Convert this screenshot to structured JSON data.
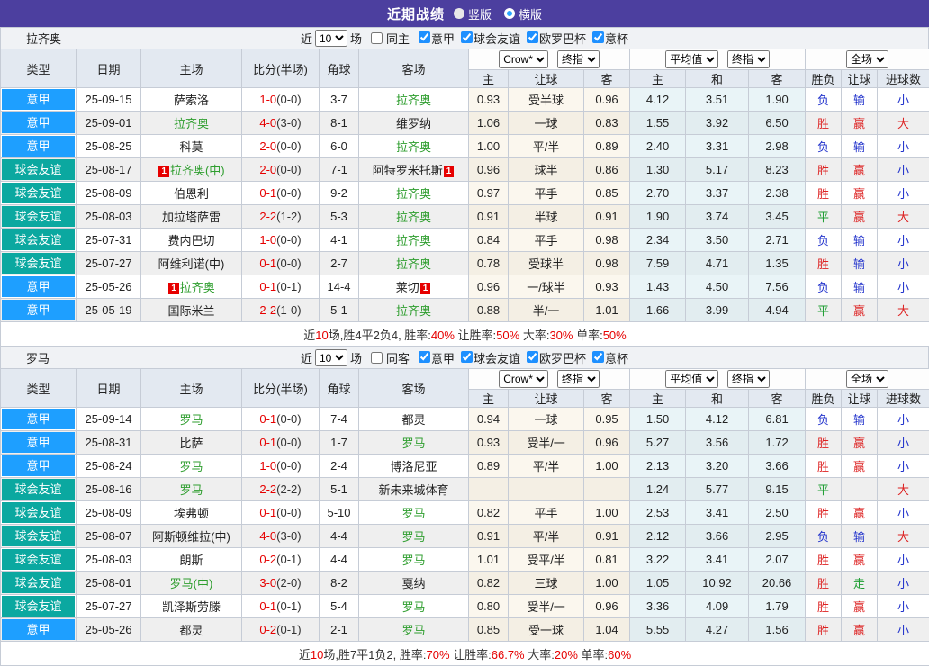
{
  "title_bar": {
    "title": "近期战绩",
    "radios": [
      {
        "label": "竖版",
        "selected": false
      },
      {
        "label": "横版",
        "selected": true
      }
    ]
  },
  "header": {
    "cols": [
      "类型",
      "日期",
      "主场",
      "比分(半场)",
      "角球",
      "客场"
    ],
    "sub": [
      "主",
      "让球",
      "客",
      "主",
      "和",
      "客",
      "胜负",
      "让球",
      "进球数"
    ],
    "selects": {
      "crow": "Crow*",
      "final1": "终指",
      "avg": "平均值",
      "final2": "终指",
      "full": "全场"
    }
  },
  "sections": [
    {
      "team": "拉齐奥",
      "filter": {
        "prefix": "近",
        "count": "10",
        "suffix": "场",
        "same": {
          "label": "同主",
          "checked": false
        },
        "leagues": [
          {
            "label": "意甲",
            "checked": true
          },
          {
            "label": "球会友谊",
            "checked": true
          },
          {
            "label": "欧罗巴杯",
            "checked": true
          },
          {
            "label": "意杯",
            "checked": true
          }
        ]
      },
      "rows": [
        {
          "league": "意甲",
          "lc": "serie",
          "date": "25-09-15",
          "home": "萨索洛",
          "hf": false,
          "hc": false,
          "score": "1-0",
          "half": "(0-0)",
          "corner": "3-7",
          "away": "拉齐奥",
          "af": true,
          "ac": false,
          "h": "0.93",
          "hd": "受半球",
          "a": "0.96",
          "m1": "4.12",
          "m2": "3.51",
          "m3": "1.90",
          "r1": "负",
          "r2": "输",
          "r3": "小"
        },
        {
          "league": "意甲",
          "lc": "serie",
          "date": "25-09-01",
          "home": "拉齐奥",
          "hf": true,
          "hc": false,
          "score": "4-0",
          "half": "(3-0)",
          "corner": "8-1",
          "away": "维罗纳",
          "af": false,
          "ac": false,
          "h": "1.06",
          "hd": "一球",
          "a": "0.83",
          "m1": "1.55",
          "m2": "3.92",
          "m3": "6.50",
          "r1": "胜",
          "r2": "赢",
          "r3": "大"
        },
        {
          "league": "意甲",
          "lc": "serie",
          "date": "25-08-25",
          "home": "科莫",
          "hf": false,
          "hc": false,
          "score": "2-0",
          "half": "(0-0)",
          "corner": "6-0",
          "away": "拉齐奥",
          "af": true,
          "ac": false,
          "h": "1.00",
          "hd": "平/半",
          "a": "0.89",
          "m1": "2.40",
          "m2": "3.31",
          "m3": "2.98",
          "r1": "负",
          "r2": "输",
          "r3": "小"
        },
        {
          "league": "球会友谊",
          "lc": "friendly",
          "date": "25-08-17",
          "home": "拉齐奥(中)",
          "hf": true,
          "hc": true,
          "score": "2-0",
          "half": "(0-0)",
          "corner": "7-1",
          "away": "阿特罗米托斯",
          "af": false,
          "ac": true,
          "h": "0.96",
          "hd": "球半",
          "a": "0.86",
          "m1": "1.30",
          "m2": "5.17",
          "m3": "8.23",
          "r1": "胜",
          "r2": "赢",
          "r3": "小"
        },
        {
          "league": "球会友谊",
          "lc": "friendly",
          "date": "25-08-09",
          "home": "伯恩利",
          "hf": false,
          "hc": false,
          "score": "0-1",
          "half": "(0-0)",
          "corner": "9-2",
          "away": "拉齐奥",
          "af": true,
          "ac": false,
          "h": "0.97",
          "hd": "平手",
          "a": "0.85",
          "m1": "2.70",
          "m2": "3.37",
          "m3": "2.38",
          "r1": "胜",
          "r2": "赢",
          "r3": "小"
        },
        {
          "league": "球会友谊",
          "lc": "friendly",
          "date": "25-08-03",
          "home": "加拉塔萨雷",
          "hf": false,
          "hc": false,
          "score": "2-2",
          "half": "(1-2)",
          "corner": "5-3",
          "away": "拉齐奥",
          "af": true,
          "ac": false,
          "h": "0.91",
          "hd": "半球",
          "a": "0.91",
          "m1": "1.90",
          "m2": "3.74",
          "m3": "3.45",
          "r1": "平",
          "r2": "赢",
          "r3": "大"
        },
        {
          "league": "球会友谊",
          "lc": "friendly",
          "date": "25-07-31",
          "home": "费内巴切",
          "hf": false,
          "hc": false,
          "score": "1-0",
          "half": "(0-0)",
          "corner": "4-1",
          "away": "拉齐奥",
          "af": true,
          "ac": false,
          "h": "0.84",
          "hd": "平手",
          "a": "0.98",
          "m1": "2.34",
          "m2": "3.50",
          "m3": "2.71",
          "r1": "负",
          "r2": "输",
          "r3": "小"
        },
        {
          "league": "球会友谊",
          "lc": "friendly",
          "date": "25-07-27",
          "home": "阿维利诺(中)",
          "hf": false,
          "hc": false,
          "score": "0-1",
          "half": "(0-0)",
          "corner": "2-7",
          "away": "拉齐奥",
          "af": true,
          "ac": false,
          "h": "0.78",
          "hd": "受球半",
          "a": "0.98",
          "m1": "7.59",
          "m2": "4.71",
          "m3": "1.35",
          "r1": "胜",
          "r2": "输",
          "r3": "小"
        },
        {
          "league": "意甲",
          "lc": "serie",
          "date": "25-05-26",
          "home": "拉齐奥",
          "hf": true,
          "hc": true,
          "score": "0-1",
          "half": "(0-1)",
          "corner": "14-4",
          "away": "莱切",
          "af": false,
          "ac": true,
          "h": "0.96",
          "hd": "一/球半",
          "a": "0.93",
          "m1": "1.43",
          "m2": "4.50",
          "m3": "7.56",
          "r1": "负",
          "r2": "输",
          "r3": "小"
        },
        {
          "league": "意甲",
          "lc": "serie",
          "date": "25-05-19",
          "home": "国际米兰",
          "hf": false,
          "hc": false,
          "score": "2-2",
          "half": "(1-0)",
          "corner": "5-1",
          "away": "拉齐奥",
          "af": true,
          "ac": false,
          "h": "0.88",
          "hd": "半/一",
          "a": "1.01",
          "m1": "1.66",
          "m2": "3.99",
          "m3": "4.94",
          "r1": "平",
          "r2": "赢",
          "r3": "大"
        }
      ],
      "summary": [
        [
          "近",
          "d"
        ],
        [
          "10",
          "r"
        ],
        [
          "场,胜4平2负4, 胜率:",
          "d"
        ],
        [
          "40%",
          "r"
        ],
        [
          " 让胜率:",
          "d"
        ],
        [
          "50%",
          "r"
        ],
        [
          " 大率:",
          "d"
        ],
        [
          "30%",
          "r"
        ],
        [
          " 单率:",
          "d"
        ],
        [
          "50%",
          "r"
        ]
      ]
    },
    {
      "team": "罗马",
      "filter": {
        "prefix": "近",
        "count": "10",
        "suffix": "场",
        "same": {
          "label": "同客",
          "checked": false
        },
        "leagues": [
          {
            "label": "意甲",
            "checked": true
          },
          {
            "label": "球会友谊",
            "checked": true
          },
          {
            "label": "欧罗巴杯",
            "checked": true
          },
          {
            "label": "意杯",
            "checked": true
          }
        ]
      },
      "rows": [
        {
          "league": "意甲",
          "lc": "serie",
          "date": "25-09-14",
          "home": "罗马",
          "hf": true,
          "hc": false,
          "score": "0-1",
          "half": "(0-0)",
          "corner": "7-4",
          "away": "都灵",
          "af": false,
          "ac": false,
          "h": "0.94",
          "hd": "一球",
          "a": "0.95",
          "m1": "1.50",
          "m2": "4.12",
          "m3": "6.81",
          "r1": "负",
          "r2": "输",
          "r3": "小"
        },
        {
          "league": "意甲",
          "lc": "serie",
          "date": "25-08-31",
          "home": "比萨",
          "hf": false,
          "hc": false,
          "score": "0-1",
          "half": "(0-0)",
          "corner": "1-7",
          "away": "罗马",
          "af": true,
          "ac": false,
          "h": "0.93",
          "hd": "受半/一",
          "a": "0.96",
          "m1": "5.27",
          "m2": "3.56",
          "m3": "1.72",
          "r1": "胜",
          "r2": "赢",
          "r3": "小"
        },
        {
          "league": "意甲",
          "lc": "serie",
          "date": "25-08-24",
          "home": "罗马",
          "hf": true,
          "hc": false,
          "score": "1-0",
          "half": "(0-0)",
          "corner": "2-4",
          "away": "博洛尼亚",
          "af": false,
          "ac": false,
          "h": "0.89",
          "hd": "平/半",
          "a": "1.00",
          "m1": "2.13",
          "m2": "3.20",
          "m3": "3.66",
          "r1": "胜",
          "r2": "赢",
          "r3": "小"
        },
        {
          "league": "球会友谊",
          "lc": "friendly",
          "date": "25-08-16",
          "home": "罗马",
          "hf": true,
          "hc": false,
          "score": "2-2",
          "half": "(2-2)",
          "corner": "5-1",
          "away": "新未来城体育",
          "af": false,
          "ac": false,
          "h": "",
          "hd": "",
          "a": "",
          "m1": "1.24",
          "m2": "5.77",
          "m3": "9.15",
          "r1": "平",
          "r2": "",
          "r3": "大"
        },
        {
          "league": "球会友谊",
          "lc": "friendly",
          "date": "25-08-09",
          "home": "埃弗顿",
          "hf": false,
          "hc": false,
          "score": "0-1",
          "half": "(0-0)",
          "corner": "5-10",
          "away": "罗马",
          "af": true,
          "ac": false,
          "h": "0.82",
          "hd": "平手",
          "a": "1.00",
          "m1": "2.53",
          "m2": "3.41",
          "m3": "2.50",
          "r1": "胜",
          "r2": "赢",
          "r3": "小"
        },
        {
          "league": "球会友谊",
          "lc": "friendly",
          "date": "25-08-07",
          "home": "阿斯顿维拉(中)",
          "hf": false,
          "hc": false,
          "score": "4-0",
          "half": "(3-0)",
          "corner": "4-4",
          "away": "罗马",
          "af": true,
          "ac": false,
          "h": "0.91",
          "hd": "平/半",
          "a": "0.91",
          "m1": "2.12",
          "m2": "3.66",
          "m3": "2.95",
          "r1": "负",
          "r2": "输",
          "r3": "大"
        },
        {
          "league": "球会友谊",
          "lc": "friendly",
          "date": "25-08-03",
          "home": "朗斯",
          "hf": false,
          "hc": false,
          "score": "0-2",
          "half": "(0-1)",
          "corner": "4-4",
          "away": "罗马",
          "af": true,
          "ac": false,
          "h": "1.01",
          "hd": "受平/半",
          "a": "0.81",
          "m1": "3.22",
          "m2": "3.41",
          "m3": "2.07",
          "r1": "胜",
          "r2": "赢",
          "r3": "小"
        },
        {
          "league": "球会友谊",
          "lc": "friendly",
          "date": "25-08-01",
          "home": "罗马(中)",
          "hf": true,
          "hc": false,
          "score": "3-0",
          "half": "(2-0)",
          "corner": "8-2",
          "away": "戛纳",
          "af": false,
          "ac": false,
          "h": "0.82",
          "hd": "三球",
          "a": "1.00",
          "m1": "1.05",
          "m2": "10.92",
          "m3": "20.66",
          "r1": "胜",
          "r2": "走",
          "r3": "小"
        },
        {
          "league": "球会友谊",
          "lc": "friendly",
          "date": "25-07-27",
          "home": "凯泽斯劳滕",
          "hf": false,
          "hc": false,
          "score": "0-1",
          "half": "(0-1)",
          "corner": "5-4",
          "away": "罗马",
          "af": true,
          "ac": false,
          "h": "0.80",
          "hd": "受半/一",
          "a": "0.96",
          "m1": "3.36",
          "m2": "4.09",
          "m3": "1.79",
          "r1": "胜",
          "r2": "赢",
          "r3": "小"
        },
        {
          "league": "意甲",
          "lc": "serie",
          "date": "25-05-26",
          "home": "都灵",
          "hf": false,
          "hc": false,
          "score": "0-2",
          "half": "(0-1)",
          "corner": "2-1",
          "away": "罗马",
          "af": true,
          "ac": false,
          "h": "0.85",
          "hd": "受一球",
          "a": "1.04",
          "m1": "5.55",
          "m2": "4.27",
          "m3": "1.56",
          "r1": "胜",
          "r2": "赢",
          "r3": "小"
        }
      ],
      "summary": [
        [
          "近",
          "d"
        ],
        [
          "10",
          "r"
        ],
        [
          "场,胜7平1负2, 胜率:",
          "d"
        ],
        [
          "70%",
          "r"
        ],
        [
          " 让胜率:",
          "d"
        ],
        [
          "66.7%",
          "r"
        ],
        [
          " 大率:",
          "d"
        ],
        [
          "20%",
          "r"
        ],
        [
          " 单率:",
          "d"
        ],
        [
          "60%",
          "r"
        ]
      ]
    }
  ]
}
